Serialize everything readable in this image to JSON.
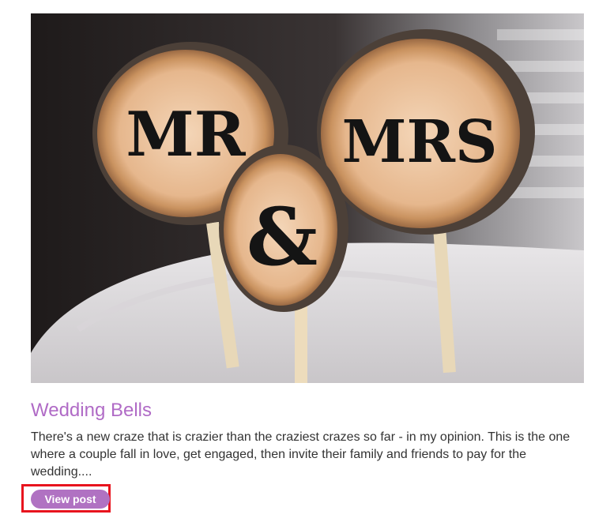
{
  "post": {
    "image": {
      "sign_left": "MR",
      "sign_center": "&",
      "sign_right": "MRS"
    },
    "title": "Wedding Bells",
    "excerpt": "There's a new craze that is crazier than the craziest crazes so far - in my opinion. This is the one where a couple fall in love, get engaged, then invite their family and friends to pay for the wedding....",
    "button_label": "View post"
  },
  "colors": {
    "title": "#b06bc6",
    "button": "#b072c2",
    "highlight": "#e8141e"
  }
}
